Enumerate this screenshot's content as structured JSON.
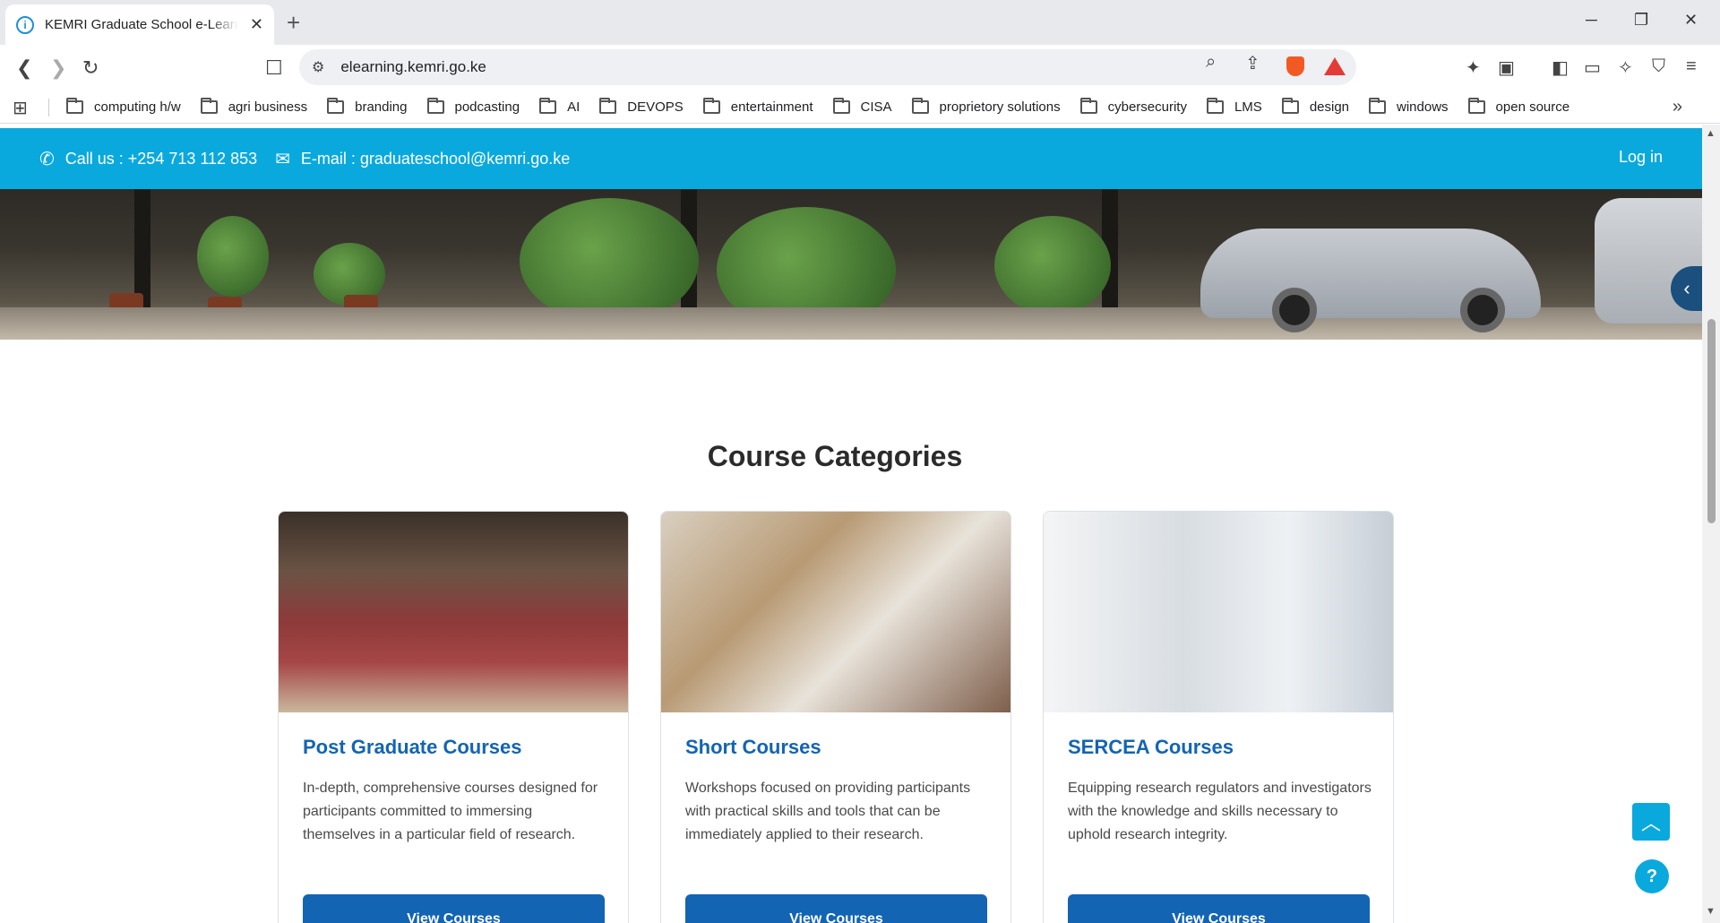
{
  "browser": {
    "tab_title": "KEMRI Graduate School e-Learning",
    "url": "elearning.kemri.go.ke",
    "bookmarks": [
      "computing h/w",
      "agri business",
      "branding",
      "podcasting",
      "AI",
      "DEVOPS",
      "entertainment",
      "CISA",
      "proprietory solutions",
      "cybersecurity",
      "LMS",
      "design",
      "windows",
      "open source"
    ]
  },
  "topbar": {
    "phone": "Call us : +254 713 112 853",
    "email": "E-mail : graduateschool@kemri.go.ke",
    "login": "Log in"
  },
  "section": {
    "title": "Course Categories"
  },
  "cards": [
    {
      "title": "Post Graduate Courses",
      "desc": "In-depth, comprehensive courses designed for participants committed to immersing themselves in a particular field of research.",
      "button": "View Courses"
    },
    {
      "title": "Short Courses",
      "desc": "Workshops focused on providing participants with practical skills and tools that can be immediately applied to their research.",
      "button": "View Courses"
    },
    {
      "title": "SERCEA Courses",
      "desc": "Equipping research regulators and investigators with the knowledge and skills necessary to uphold research integrity.",
      "button": "View Courses"
    }
  ],
  "colors": {
    "topbar": "#0aa9dd",
    "brand_blue": "#1364b3"
  }
}
